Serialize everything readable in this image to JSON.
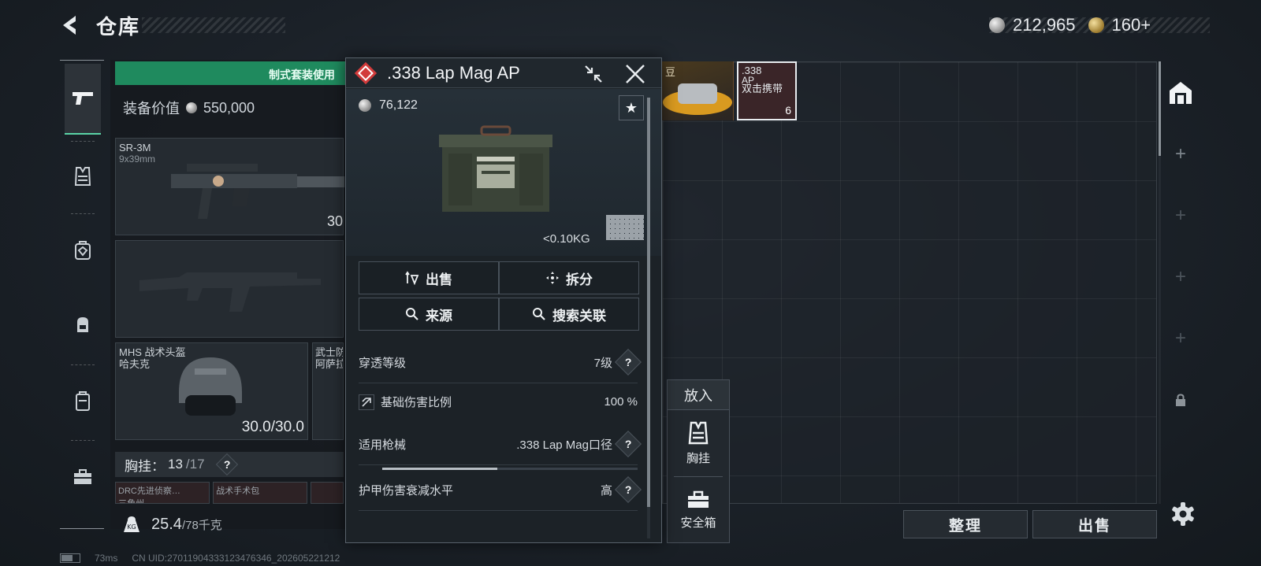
{
  "header": {
    "title": "仓库",
    "currency": {
      "coins": "212,965",
      "premium": "160+"
    }
  },
  "left_rail": {
    "items": [
      {
        "name": "weapons",
        "active": true
      },
      {
        "name": "chest-rig"
      },
      {
        "name": "backpack-armor"
      },
      {
        "name": "backpack"
      },
      {
        "name": "container"
      },
      {
        "name": "safe-box"
      }
    ]
  },
  "loadout": {
    "banner": "制式套装使用",
    "value_label": "装备价值",
    "value": "550,000",
    "primary_weapon": {
      "name": "SR-3M",
      "caliber": "9x39mm",
      "count": "30"
    },
    "helmet": {
      "name": "MHS 战术头盔",
      "sub": "哈夫克",
      "durability": "30.0/30.0"
    },
    "armor": {
      "name": "武士防",
      "sub": "阿萨拉"
    },
    "chest_rig": {
      "label": "胸挂：",
      "current": "13",
      "max": "/17"
    },
    "chest_items": [
      "DRC先进侦察…",
      "战术手术包"
    ],
    "chest_item_sub": "三角州",
    "weight": {
      "current": "25.4",
      "max": "/78千克"
    }
  },
  "storage": {
    "item1_label": "豆",
    "item2": {
      "line1": ".338",
      "line2": "AP",
      "line3": "双击携带",
      "count": "6"
    }
  },
  "detail": {
    "title": ".338 Lap Mag AP",
    "price": "76,122",
    "weight": "<0.10KG",
    "actions": {
      "sell": "出售",
      "disassemble": "拆分",
      "source": "来源",
      "search": "搜索关联"
    },
    "stats": [
      {
        "label": "穿透等级",
        "value": "7级"
      },
      {
        "label": "基础伤害比例",
        "value": "100 %",
        "fill_fraction": 0.45
      },
      {
        "label": "适用枪械",
        "value": ".338 Lap Mag口径"
      },
      {
        "label": "护甲伤害衰减水平",
        "value": "高"
      }
    ]
  },
  "put_in": {
    "title": "放入",
    "options": [
      "胸挂",
      "安全箱"
    ]
  },
  "bottom_buttons": {
    "organize": "整理",
    "sell": "出售"
  },
  "status": {
    "ping": "73ms",
    "uid": "CN UID:27011904333123476346_202605221212"
  },
  "colors": {
    "accent_green": "#1f8a5e",
    "rarity_red": "#d23b3b",
    "selected_border": "#e8ecef"
  }
}
